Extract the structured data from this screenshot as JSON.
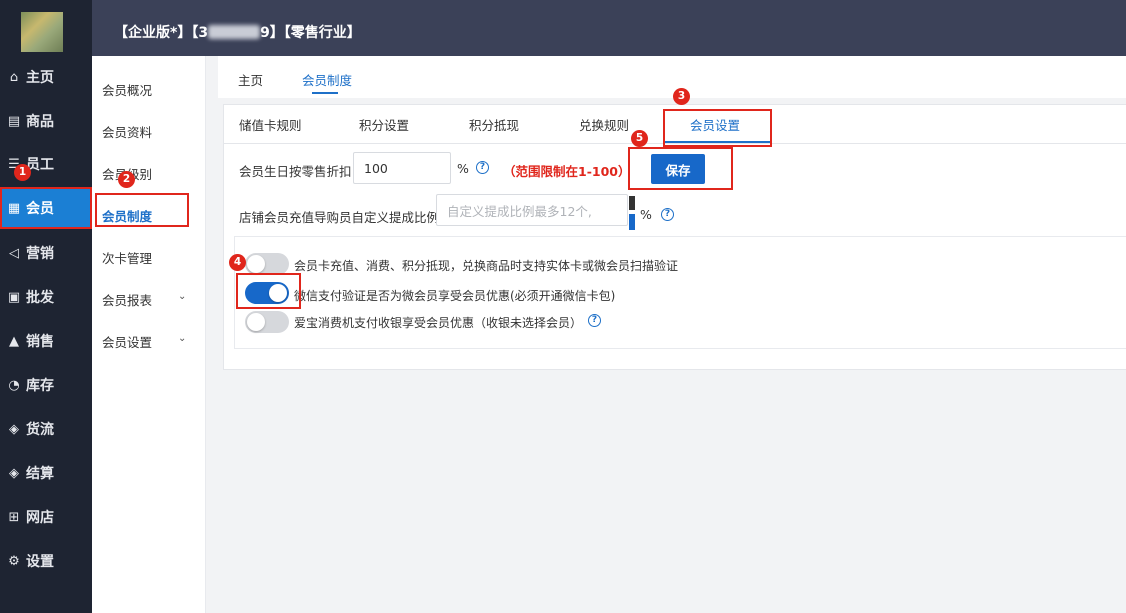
{
  "sidebar": {
    "items": [
      {
        "label": "主页",
        "icon": "⌂"
      },
      {
        "label": "商品",
        "icon": "▤"
      },
      {
        "label": "员工",
        "icon": "☰"
      },
      {
        "label": "会员",
        "icon": "▦"
      },
      {
        "label": "营销",
        "icon": "◁"
      },
      {
        "label": "批发",
        "icon": "▣"
      },
      {
        "label": "销售",
        "icon": "▲"
      },
      {
        "label": "库存",
        "icon": "◔"
      },
      {
        "label": "货流",
        "icon": "◈"
      },
      {
        "label": "结算",
        "icon": "◈"
      },
      {
        "label": "网店",
        "icon": "⊞"
      },
      {
        "label": "设置",
        "icon": "⚙"
      }
    ]
  },
  "header": {
    "title_prefix": "【企业版*】【3",
    "title_suffix": "9】【零售行业】"
  },
  "subnav": {
    "items": [
      {
        "label": "会员概况"
      },
      {
        "label": "会员资料"
      },
      {
        "label": "会员级别"
      },
      {
        "label": "会员制度"
      },
      {
        "label": "次卡管理"
      },
      {
        "label": "会员报表"
      },
      {
        "label": "会员设置"
      }
    ]
  },
  "breadcrumb": {
    "home": "主页",
    "current": "会员制度"
  },
  "tabs": [
    {
      "label": "储值卡规则"
    },
    {
      "label": "积分设置"
    },
    {
      "label": "积分抵现"
    },
    {
      "label": "兑换规则"
    },
    {
      "label": "会员设置"
    }
  ],
  "form": {
    "birthday_label": "会员生日按零售折扣",
    "birthday_value": "100",
    "percent": "%",
    "range_hint": "（范围限制在1-100）",
    "save_label": "保存",
    "commission_label": "店铺会员充值导购员自定义提成比例",
    "commission_placeholder": "自定义提成比例最多12个,",
    "help_symbol": "?"
  },
  "toggles": [
    {
      "label": "会员卡充值、消费、积分抵现，兑换商品时支持实体卡或微会员扫描验证",
      "on": false
    },
    {
      "label": "微信支付验证是否为微会员享受会员优惠(必须开通微信卡包)",
      "on": true
    },
    {
      "label": "爱宝消费机支付收银享受会员优惠（收银未选择会员）",
      "on": false
    }
  ],
  "annotations": [
    "1",
    "2",
    "3",
    "4",
    "5"
  ],
  "colors": {
    "accent": "#1768c9",
    "highlight": "#e0261c",
    "sidebar_bg": "#1e2432",
    "topbar_bg": "#3b4158"
  }
}
